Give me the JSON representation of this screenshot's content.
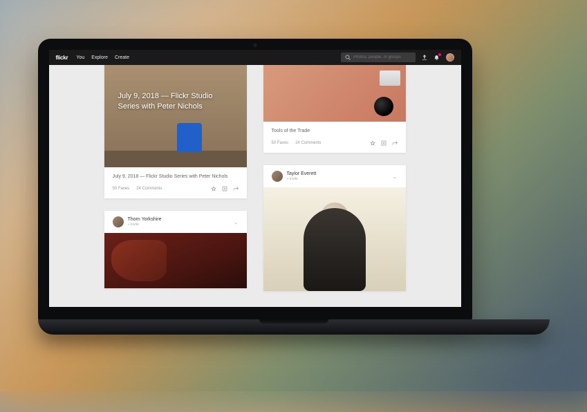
{
  "brand": "flickr",
  "nav": {
    "you": "You",
    "explore": "Explore",
    "create": "Create"
  },
  "search": {
    "placeholder": "Photos, people, or groups"
  },
  "cards": {
    "a": {
      "overlay": "July 9, 2018 — Flickr Studio Series with Peter Nichols",
      "caption": "July 9, 2018 — Flickr Studio Series with Peter Nichols",
      "faves": "50 Faves",
      "comments": "24 Comments"
    },
    "b": {
      "caption": "Tools of the Trade",
      "faves": "50 Faves",
      "comments": "24 Comments"
    },
    "c": {
      "author": "Thorn Yorkshire",
      "sub": "+ Invite"
    },
    "d": {
      "author": "Taylor Everett",
      "sub": "+ Invite"
    }
  }
}
